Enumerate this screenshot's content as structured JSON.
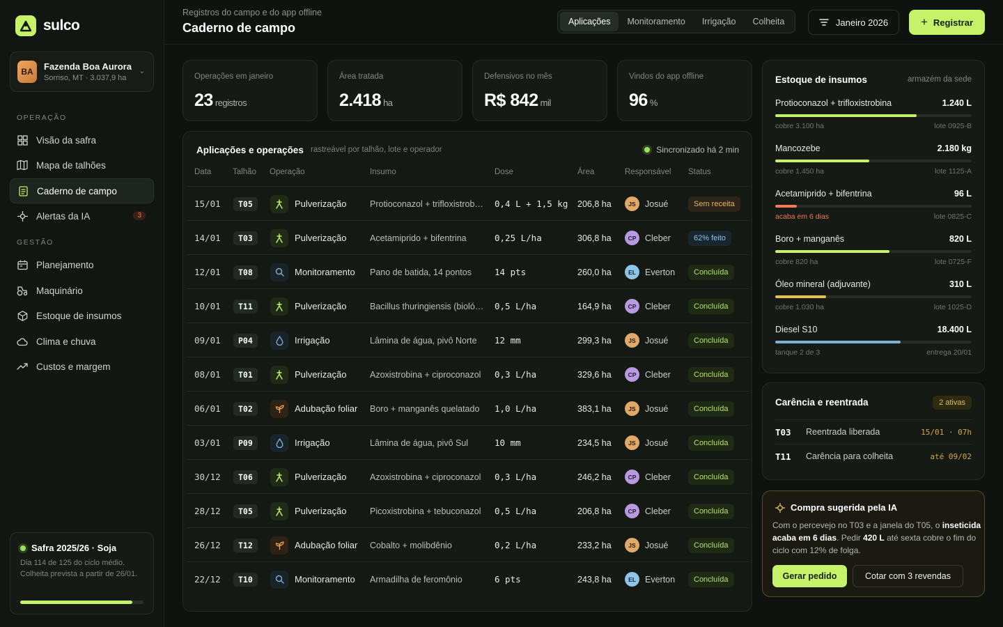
{
  "brand": {
    "name": "sulco"
  },
  "farm": {
    "initials": "BA",
    "name": "Fazenda Boa Aurora",
    "sub": "Sorriso, MT · 3.037,9 ha"
  },
  "nav": {
    "section_ops": "OPERAÇÃO",
    "section_mgmt": "GESTÃO",
    "items": [
      {
        "label": "Visão da safra",
        "icon": "grid-icon"
      },
      {
        "label": "Mapa de talhões",
        "icon": "map-icon"
      },
      {
        "label": "Caderno de campo",
        "icon": "notebook-icon",
        "active": true
      },
      {
        "label": "Alertas da IA",
        "icon": "sparkle-icon",
        "badge": "3"
      },
      {
        "label": "Planejamento",
        "icon": "calendar-icon"
      },
      {
        "label": "Maquinário",
        "icon": "tractor-icon"
      },
      {
        "label": "Estoque de insumos",
        "icon": "box-icon"
      },
      {
        "label": "Clima e chuva",
        "icon": "cloud-icon"
      },
      {
        "label": "Custos e margem",
        "icon": "trend-icon"
      }
    ]
  },
  "season": {
    "title": "Safra 2025/26 · Soja",
    "desc": "Dia 114 de 125 do ciclo médio. Colheita prevista a partir de 26/01.",
    "progress": 0.912
  },
  "header": {
    "crumb": "Registros do campo e do app offline",
    "title": "Caderno de campo",
    "tabs": [
      "Aplicações",
      "Monitoramento",
      "Irrigação",
      "Colheita"
    ],
    "month": "Janeiro 2026",
    "register": "Registrar"
  },
  "kpis": [
    {
      "label": "Operações em janeiro",
      "value": "23",
      "unit": "registros"
    },
    {
      "label": "Área tratada",
      "value": "2.418",
      "unit": "ha"
    },
    {
      "label": "Defensivos no mês",
      "value": "R$ 842",
      "unit": "mil"
    },
    {
      "label": "Vindos do app offline",
      "value": "96",
      "unit": "%"
    }
  ],
  "table": {
    "title": "Aplicações e operações",
    "subtitle": "rastreável por talhão, lote e operador",
    "sync": "Sincronizado há 2 min",
    "headers": [
      "Data",
      "Talhão",
      "Operação",
      "Insumo",
      "Dose",
      "Área",
      "Responsável",
      "Status"
    ],
    "rows": [
      {
        "date": "15/01",
        "plot": "T05",
        "op": "Pulverização",
        "opType": "spray",
        "input": "Protioconazol + trifloxistrobina",
        "dose": "0,4 L + 1,5 kg",
        "area": "206,8 ha",
        "init": "JS",
        "resp": "Josué",
        "status": "Sem receita",
        "st": "warn"
      },
      {
        "date": "14/01",
        "plot": "T03",
        "op": "Pulverização",
        "opType": "spray",
        "input": "Acetamiprido + bifentrina",
        "dose": "0,25 L/ha",
        "area": "306,8 ha",
        "init": "CP",
        "resp": "Cleber",
        "status": "62% feito",
        "st": "prog"
      },
      {
        "date": "12/01",
        "plot": "T08",
        "op": "Monitoramento",
        "opType": "monitor",
        "input": "Pano de batida, 14 pontos",
        "dose": "14 pts",
        "area": "260,0 ha",
        "init": "EL",
        "resp": "Everton",
        "status": "Concluída",
        "st": "ok"
      },
      {
        "date": "10/01",
        "plot": "T11",
        "op": "Pulverização",
        "opType": "spray",
        "input": "Bacillus thuringiensis (biológico)",
        "dose": "0,5 L/ha",
        "area": "164,9 ha",
        "init": "CP",
        "resp": "Cleber",
        "status": "Concluída",
        "st": "ok"
      },
      {
        "date": "09/01",
        "plot": "P04",
        "op": "Irrigação",
        "opType": "irrig",
        "input": "Lâmina de água, pivô Norte",
        "dose": "12 mm",
        "area": "299,3 ha",
        "init": "JS",
        "resp": "Josué",
        "status": "Concluída",
        "st": "ok"
      },
      {
        "date": "08/01",
        "plot": "T01",
        "op": "Pulverização",
        "opType": "spray",
        "input": "Azoxistrobina + ciproconazol",
        "dose": "0,3 L/ha",
        "area": "329,6 ha",
        "init": "CP",
        "resp": "Cleber",
        "status": "Concluída",
        "st": "ok"
      },
      {
        "date": "06/01",
        "plot": "T02",
        "op": "Adubação foliar",
        "opType": "fert",
        "input": "Boro + manganês quelatado",
        "dose": "1,0 L/ha",
        "area": "383,1 ha",
        "init": "JS",
        "resp": "Josué",
        "status": "Concluída",
        "st": "ok"
      },
      {
        "date": "03/01",
        "plot": "P09",
        "op": "Irrigação",
        "opType": "irrig",
        "input": "Lâmina de água, pivô Sul",
        "dose": "10 mm",
        "area": "234,5 ha",
        "init": "JS",
        "resp": "Josué",
        "status": "Concluída",
        "st": "ok"
      },
      {
        "date": "30/12",
        "plot": "T06",
        "op": "Pulverização",
        "opType": "spray",
        "input": "Azoxistrobina + ciproconazol",
        "dose": "0,3 L/ha",
        "area": "246,2 ha",
        "init": "CP",
        "resp": "Cleber",
        "status": "Concluída",
        "st": "ok"
      },
      {
        "date": "28/12",
        "plot": "T05",
        "op": "Pulverização",
        "opType": "spray",
        "input": "Picoxistrobina + tebuconazol",
        "dose": "0,5 L/ha",
        "area": "206,8 ha",
        "init": "CP",
        "resp": "Cleber",
        "status": "Concluída",
        "st": "ok"
      },
      {
        "date": "26/12",
        "plot": "T12",
        "op": "Adubação foliar",
        "opType": "fert",
        "input": "Cobalto + molibdênio",
        "dose": "0,2 L/ha",
        "area": "233,2 ha",
        "init": "JS",
        "resp": "Josué",
        "status": "Concluída",
        "st": "ok"
      },
      {
        "date": "22/12",
        "plot": "T10",
        "op": "Monitoramento",
        "opType": "monitor",
        "input": "Armadilha de feromônio",
        "dose": "6 pts",
        "area": "243,8 ha",
        "init": "EL",
        "resp": "Everton",
        "status": "Concluída",
        "st": "ok"
      }
    ]
  },
  "stock": {
    "title": "Estoque de insumos",
    "sub": "armazém da sede",
    "items": [
      {
        "name": "Protioconazol + trifloxistrobina",
        "qty": "1.240 L",
        "fill": 0.72,
        "color": "#c6f26a",
        "left": "cobre 3.100 ha",
        "right": "lote 0925-B",
        "alert": false
      },
      {
        "name": "Mancozebe",
        "qty": "2.180 kg",
        "fill": 0.48,
        "color": "#c6f26a",
        "left": "cobre 1.450 ha",
        "right": "lote 1125-A",
        "alert": false
      },
      {
        "name": "Acetamiprido + bifentrina",
        "qty": "96 L",
        "fill": 0.11,
        "color": "#ef7a55",
        "left": "acaba em 6 dias",
        "right": "lote 0825-C",
        "alert": true
      },
      {
        "name": "Boro + manganês",
        "qty": "820 L",
        "fill": 0.58,
        "color": "#c6f26a",
        "left": "cobre 820 ha",
        "right": "lote 0725-F",
        "alert": false
      },
      {
        "name": "Óleo mineral (adjuvante)",
        "qty": "310 L",
        "fill": 0.26,
        "color": "#e3c15a",
        "left": "cobre 1.030 ha",
        "right": "lote 1025-D",
        "alert": false
      },
      {
        "name": "Diesel S10",
        "qty": "18.400 L",
        "fill": 0.64,
        "color": "#7fb3d6",
        "left": "tanque 2 de 3",
        "right": "entrega 20/01",
        "alert": false
      }
    ]
  },
  "carencia": {
    "title": "Carência e reentrada",
    "badge": "2 ativas",
    "rows": [
      {
        "plot": "T03",
        "desc": "Reentrada liberada",
        "when": "15/01 · 07h"
      },
      {
        "plot": "T11",
        "desc": "Carência para colheita",
        "when": "até 09/02"
      }
    ]
  },
  "ai": {
    "title": "Compra sugerida pela IA",
    "text1": "Com o percevejo no T03 e a janela do T05, o ",
    "bold1": "inseticida acaba em 6 dias",
    "text2": ". Pedir ",
    "bold2": "420 L",
    "text3": " até sexta cobre o fim do ciclo com 12% de folga.",
    "primary": "Gerar pedido",
    "secondary": "Cotar com 3 revendas"
  }
}
